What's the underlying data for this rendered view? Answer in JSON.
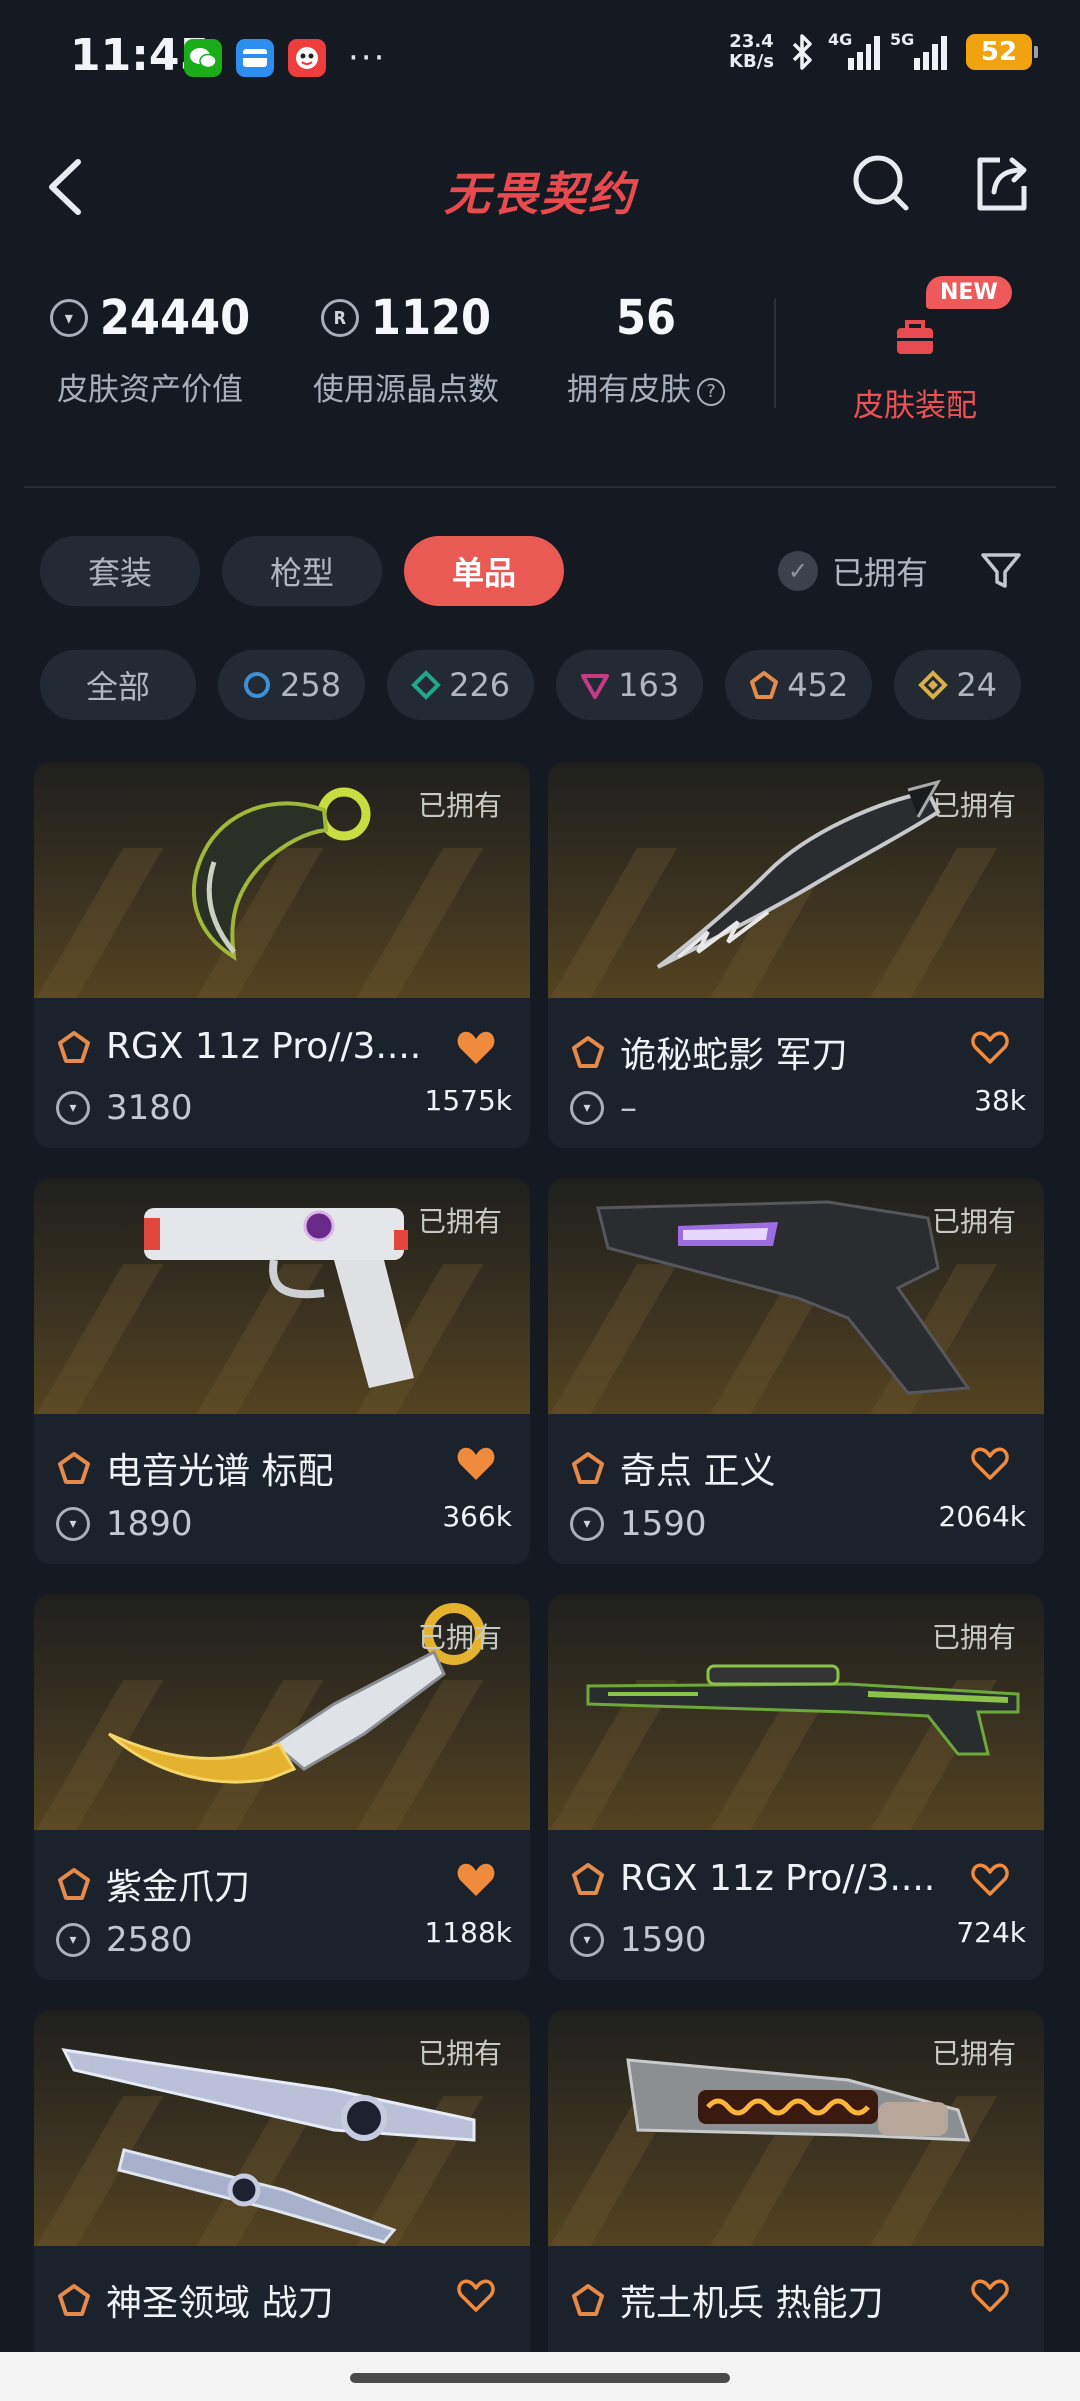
{
  "status_bar": {
    "time": "11:45",
    "more": "···",
    "speed_value": "23.4",
    "speed_unit": "KB/s",
    "signal1": "4G",
    "signal2": "5G",
    "battery": "52"
  },
  "header": {
    "title": "无畏契约"
  },
  "stats": {
    "asset_value": "24440",
    "asset_label": "皮肤资产价值",
    "points": "1120",
    "points_label": "使用源晶点数",
    "owned_count": "56",
    "owned_label": "拥有皮肤",
    "outfit_label": "皮肤装配",
    "new_badge": "NEW"
  },
  "tabs": [
    {
      "label": "套装",
      "active": false
    },
    {
      "label": "枪型",
      "active": false
    },
    {
      "label": "单品",
      "active": true
    }
  ],
  "owned_filter_label": "已拥有",
  "tier_chips": [
    {
      "label": "全部"
    },
    {
      "label": "258",
      "tier": "select",
      "color": "#3d8fd6"
    },
    {
      "label": "226",
      "tier": "deluxe",
      "color": "#1fa88a"
    },
    {
      "label": "163",
      "tier": "premium",
      "color": "#c53b86"
    },
    {
      "label": "452",
      "tier": "exclusive",
      "color": "#e48a4a"
    },
    {
      "label": "24",
      "tier": "ultra",
      "color": "#d8b04a"
    }
  ],
  "owned_tag": "已拥有",
  "items": [
    {
      "name": "RGX 11z Pro//3....",
      "price": "3180",
      "likes": "1575k",
      "favorited": true
    },
    {
      "name": "诡秘蛇影 军刀",
      "price": "–",
      "likes": "38k",
      "favorited": false
    },
    {
      "name": "电音光谱 标配",
      "price": "1890",
      "likes": "366k",
      "favorited": true
    },
    {
      "name": "奇点 正义",
      "price": "1590",
      "likes": "2064k",
      "favorited": false
    },
    {
      "name": "紫金爪刀",
      "price": "2580",
      "likes": "1188k",
      "favorited": true
    },
    {
      "name": "RGX 11z Pro//3....",
      "price": "1590",
      "likes": "724k",
      "favorited": false
    },
    {
      "name": "神圣领域 战刀",
      "price": "",
      "likes": "",
      "favorited": false
    },
    {
      "name": "荒土机兵 热能刀",
      "price": "",
      "likes": "",
      "favorited": false
    }
  ],
  "colors": {
    "accent": "#ea5a55",
    "heart_filled": "#f08a3c",
    "background": "#151a22"
  }
}
